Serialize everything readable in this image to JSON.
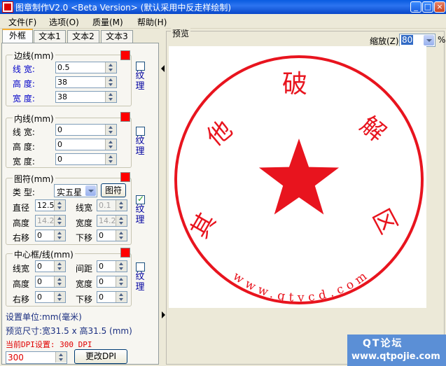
{
  "window": {
    "title": "图章制作V2.0 <Beta Version> (默认采用中反走样绘制)"
  },
  "menu": {
    "items": [
      "文件(F)",
      "选项(O)",
      "质量(M)",
      "帮助(H)"
    ]
  },
  "tabs": [
    "外框",
    "文本1",
    "文本2",
    "文本3"
  ],
  "border_group": {
    "title": "边线(mm)",
    "line_width_label": "线 宽:",
    "line_width": "0.5",
    "height_label": "高 度:",
    "height": "38",
    "width_label": "宽 度:",
    "width": "38",
    "texture_label": "纹理"
  },
  "inner_group": {
    "title": "内线(mm)",
    "line_width_label": "线 宽:",
    "line_width": "0",
    "height_label": "高 度:",
    "height": "0",
    "width_label": "宽 度:",
    "width": "0",
    "texture_label": "纹理"
  },
  "symbol_group": {
    "title": "图符(mm)",
    "type_label": "类 型:",
    "type_value": "实五星",
    "symbol_button": "图符",
    "diameter_label": "直径",
    "diameter": "12.5",
    "stroke_label": "线宽",
    "stroke": "0.1",
    "height_label": "高度",
    "height": "14.2",
    "width_label": "宽度",
    "width": "14.2",
    "right_label": "右移",
    "right": "0",
    "down_label": "下移",
    "down": "0",
    "texture_label": "纹理",
    "texture_checked": true
  },
  "center_group": {
    "title": "中心框/线(mm)",
    "stroke_label": "线宽",
    "stroke": "0",
    "spacing_label": "间距",
    "spacing": "0",
    "height_label": "高度",
    "height": "0",
    "width_label": "宽度",
    "width": "0",
    "right_label": "右移",
    "right": "0",
    "down_label": "下移",
    "down": "0",
    "texture_label": "纹理"
  },
  "info": {
    "unit": "设置单位:mm(毫米)",
    "preview_size": "预览尺寸:宽31.5 x 高31.5 (mm)",
    "dpi_current": "当前DPI设置: 300 DPI",
    "dpi_value": "300",
    "change_dpi_button": "更改DPI"
  },
  "preview": {
    "label": "预览",
    "zoom_label": "缩放(Z)",
    "zoom_value": "80",
    "zoom_unit": "%",
    "stamp_chars": [
      "其",
      "他",
      "破",
      "解",
      "区"
    ],
    "stamp_url": "www.qtvcd.com",
    "stamp_color": "#e8141e"
  },
  "watermark": {
    "line1": "QT论坛",
    "line2": "www.qtpojie.com"
  }
}
